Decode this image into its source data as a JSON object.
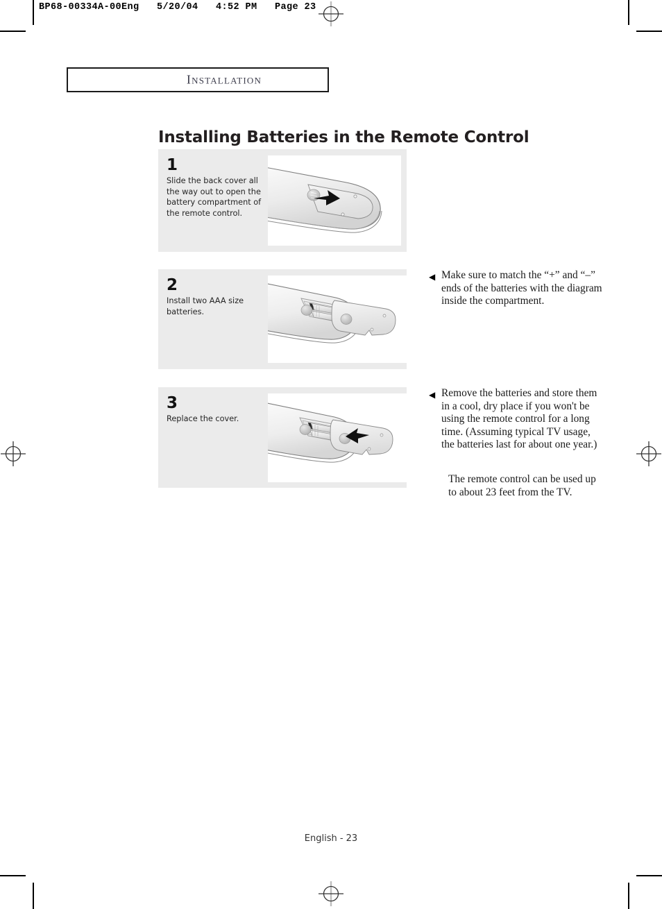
{
  "print_slug": "BP68-00334A-00Eng   5/20/04   4:52 PM   Page 23",
  "section": {
    "label": "Installation"
  },
  "title": "Installing Batteries in the Remote Control",
  "steps": [
    {
      "number": "1",
      "text": "Slide the back cover all the way out to open the battery compartment of the remote control.",
      "figure": "remote-back-cover-slide-open-diagram"
    },
    {
      "number": "2",
      "text": "Install two AAA size batteries.",
      "figure": "remote-battery-compartment-insert-batteries-diagram"
    },
    {
      "number": "3",
      "text": "Replace the cover.",
      "figure": "remote-back-cover-replace-diagram"
    }
  ],
  "notes": [
    {
      "bullet": "◀",
      "text": "Make sure to match the “+” and “–” ends of the batteries with the diagram inside the compartment."
    },
    {
      "bullet": "◀",
      "text": "Remove the batteries and store them in a cool, dry place if you won't be using the remote control for a long time. (Assuming typical TV usage, the batteries last for about one year.)"
    }
  ],
  "note_extra": "The remote control can be used up to about 23 feet from the TV.",
  "footer": "English - 23",
  "colors": {
    "panel_bg": "#ebebeb",
    "figure_bg": "#ffffff",
    "ink": "#231f20",
    "section_label": "#3b3b4a"
  }
}
